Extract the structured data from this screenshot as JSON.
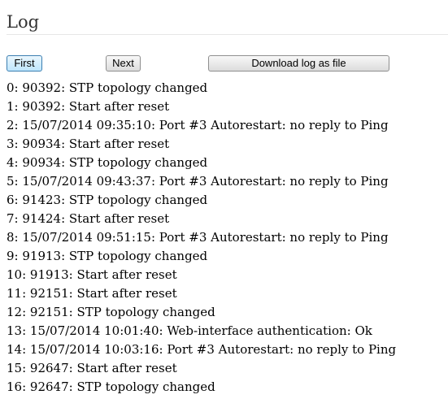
{
  "header": {
    "title": "Log"
  },
  "toolbar": {
    "first_label": "First",
    "next_label": "Next",
    "download_label": "Download log as file"
  },
  "log": {
    "lines": [
      "0: 90392: STP topology changed",
      "1: 90392: Start after reset",
      "2: 15/07/2014 09:35:10: Port #3 Autorestart: no reply to Ping",
      "3: 90934: Start after reset",
      "4: 90934: STP topology changed",
      "5: 15/07/2014 09:43:37: Port #3 Autorestart: no reply to Ping",
      "6: 91423: STP topology changed",
      "7: 91424: Start after reset",
      "8: 15/07/2014 09:51:15: Port #3 Autorestart: no reply to Ping",
      "9: 91913: STP topology changed",
      "10: 91913: Start after reset",
      "11: 92151: Start after reset",
      "12: 92151: STP topology changed",
      "13: 15/07/2014 10:01:40: Web-interface authentication: Ok",
      "14: 15/07/2014 10:03:16: Port #3 Autorestart: no reply to Ping",
      "15: 92647: Start after reset",
      "16: 92647: STP topology changed"
    ]
  }
}
